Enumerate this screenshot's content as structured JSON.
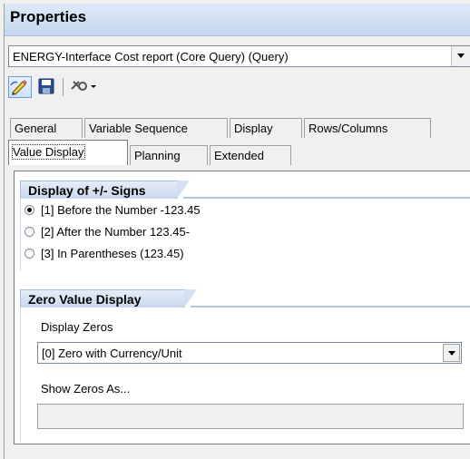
{
  "panel": {
    "title": "Properties"
  },
  "query": {
    "selected": "ENERGY-Interface Cost report (Core Query) (Query)"
  },
  "toolbar": {
    "buttons": [
      {
        "icon": "edit-pencil-icon"
      },
      {
        "icon": "save-icon"
      },
      {
        "icon": "tools-dropdown-icon"
      }
    ]
  },
  "tabs": {
    "row1": [
      "General",
      "Variable Sequence",
      "Display",
      "Rows/Columns"
    ],
    "row2": [
      "Value Display",
      "Planning",
      "Extended"
    ],
    "selected": "Value Display"
  },
  "sign_display": {
    "title": "Display of +/- Signs",
    "options": [
      {
        "label": "[1] Before the Number   -123.45",
        "checked": true
      },
      {
        "label": "[2] After the Number  123.45-",
        "checked": false
      },
      {
        "label": "[3] In Parentheses (123.45)",
        "checked": false
      }
    ]
  },
  "zero_display": {
    "title": "Zero Value Display",
    "display_zeros_label": "Display Zeros",
    "display_zeros_value": "[0] Zero with Currency/Unit",
    "show_zeros_as_label": "Show Zeros As...",
    "show_zeros_as_value": ""
  },
  "colors": {
    "header_gradient_top": "#dde9f7",
    "header_gradient_bottom": "#c6d8ef",
    "accent_border": "#6b9ad4"
  }
}
